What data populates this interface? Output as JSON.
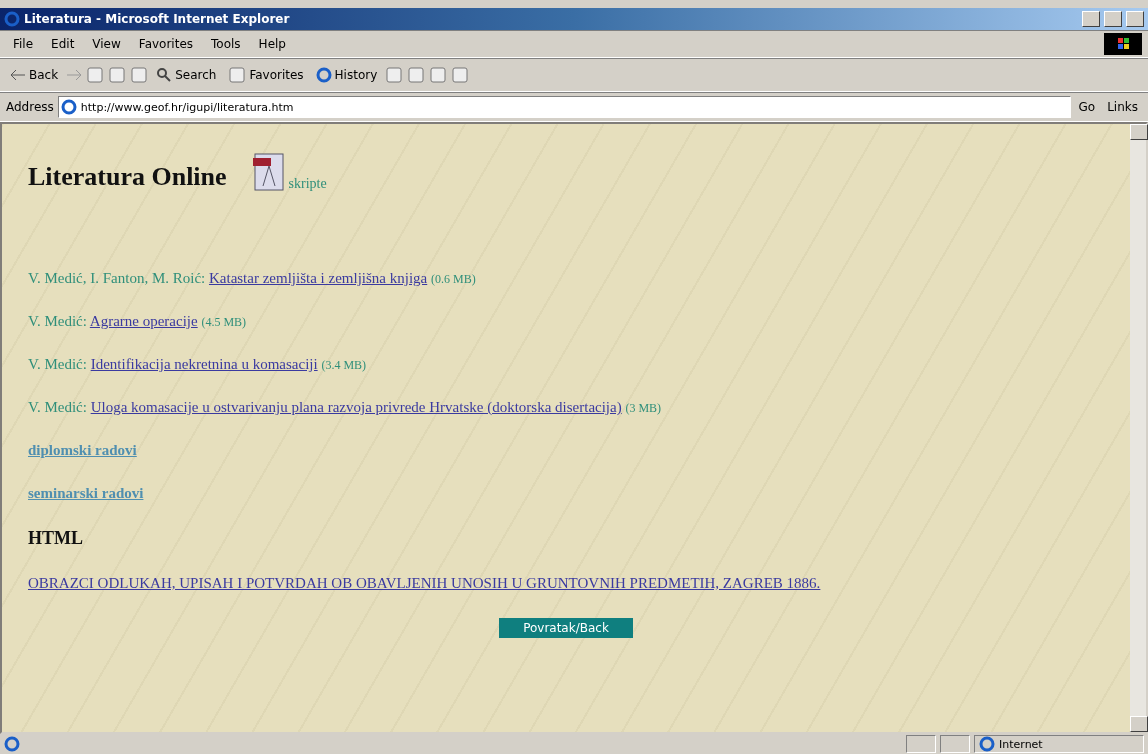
{
  "window": {
    "title": "Literatura - Microsoft Internet Explorer"
  },
  "menu": [
    "File",
    "Edit",
    "View",
    "Favorites",
    "Tools",
    "Help"
  ],
  "toolbar": {
    "back": "Back",
    "search": "Search",
    "favorites": "Favorites",
    "history": "History"
  },
  "address": {
    "label": "Address",
    "value": "http://www.geof.hr/igupi/literatura.htm",
    "go": "Go",
    "links": "Links"
  },
  "page": {
    "heading": "Literatura Online",
    "pdf_link": "skripte",
    "items": [
      {
        "kind": "paper",
        "authors": "V. Medić, I. Fanton, M. Roić:",
        "title": "Katastar zemljišta i zemljišna knjiga",
        "size": "(0.6 MB)"
      },
      {
        "kind": "paper",
        "authors": "V. Medić:",
        "title": "Agrarne operacije",
        "size": "(4.5 MB)"
      },
      {
        "kind": "paper",
        "authors": "V. Medić:",
        "title": "Identifikacija nekretnina u komasaciji",
        "size": "(3.4 MB)"
      },
      {
        "kind": "paper",
        "authors": "V. Medić:",
        "title": "Uloga komasacije u ostvarivanju plana razvoja privrede Hrvatske (doktorska disertacija)",
        "size": "(3 MB)"
      },
      {
        "kind": "section_link",
        "title": "diplomski radovi"
      },
      {
        "kind": "section_link",
        "title": "seminarski radovi"
      },
      {
        "kind": "heading",
        "title": "HTML"
      },
      {
        "kind": "doc_link",
        "title": "OBRAZCI ODLUKAH, UPISAH I POTVRDAH OB OBAVLJENIH UNOSIH U GRUNTOVNIH PREDMETIH, ZAGREB 1886."
      }
    ],
    "back_button": "Povratak/Back"
  },
  "status_bar": {
    "zone": "Internet"
  }
}
